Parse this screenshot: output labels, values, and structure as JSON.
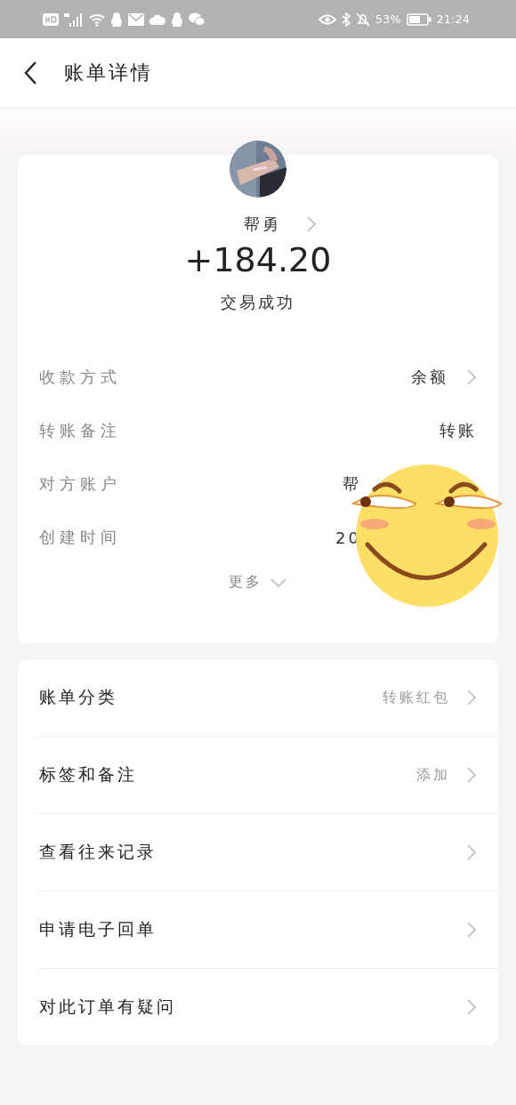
{
  "status_bar": {
    "battery_percent": "53%",
    "time": "21:24"
  },
  "header": {
    "title": "账单详情"
  },
  "summary": {
    "name": "帮勇",
    "amount": "+184.20",
    "status": "交易成功"
  },
  "detail_rows": [
    {
      "label": "收款方式",
      "value": "余额",
      "arrow": true
    },
    {
      "label": "转账备注",
      "value": "转账",
      "arrow": false
    },
    {
      "label": "对方账户",
      "value": "帮",
      "arrow": false
    },
    {
      "label": "创建时间",
      "value": "20",
      "arrow": false
    }
  ],
  "more": {
    "label": "更多"
  },
  "action_rows": [
    {
      "label": "账单分类",
      "value": "转账红包"
    },
    {
      "label": "标签和备注",
      "value": "添加"
    },
    {
      "label": "查看往来记录"
    },
    {
      "label": "申请电子回单"
    },
    {
      "label": "对此订单有疑问"
    }
  ]
}
